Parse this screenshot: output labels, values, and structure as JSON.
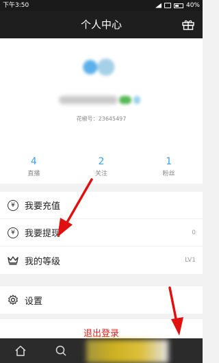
{
  "status": {
    "time": "下午3:50",
    "battery": "40%"
  },
  "header": {
    "title": "个人中心"
  },
  "profile": {
    "id_line": "花椒号：23645497"
  },
  "stats": [
    {
      "num": "4",
      "label": "直播"
    },
    {
      "num": "2",
      "label": "关注"
    },
    {
      "num": "1",
      "label": "粉丝"
    }
  ],
  "menu": [
    {
      "label": "我要充值",
      "value": ""
    },
    {
      "label": "我要提现",
      "value": "0"
    },
    {
      "label": "我的等级",
      "value": "LV1"
    }
  ],
  "settings": {
    "label": "设置"
  },
  "logout": {
    "label": "退出登录"
  },
  "colors": {
    "accent": "#38a0e6",
    "danger": "#e02020",
    "arrow": "#e01010"
  }
}
